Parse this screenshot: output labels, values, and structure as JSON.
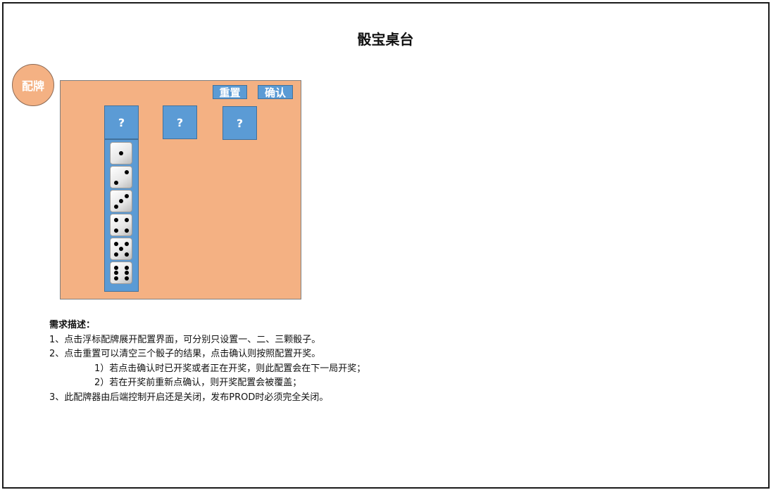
{
  "page": {
    "title": "骰宝桌台"
  },
  "float_button": {
    "label": "配牌"
  },
  "config_panel": {
    "reset_label": "重置",
    "confirm_label": "确认",
    "slots": [
      {
        "label": "?"
      },
      {
        "label": "?"
      },
      {
        "label": "?"
      }
    ],
    "dice_options": [
      1,
      2,
      3,
      4,
      5,
      6
    ]
  },
  "description": {
    "heading": "需求描述：",
    "line1": "1、点击浮标配牌展开配置界面，可分别只设置一、二、三颗骰子。",
    "line2": "2、点击重置可以清空三个骰子的结果，点击确认则按照配置开奖。",
    "line2a": "1）若点击确认时已开奖或者正在开奖，则此配置会在下一局开奖；",
    "line2b": "2）若在开奖前重新点确认，则开奖配置会被覆盖；",
    "line3": "3、此配牌器由后端控制开启还是关闭，发布PROD时必须完全关闭。"
  },
  "colors": {
    "panel_bg": "#f4b183",
    "button_bg": "#5b9bd5",
    "button_text": "#ffffff"
  }
}
